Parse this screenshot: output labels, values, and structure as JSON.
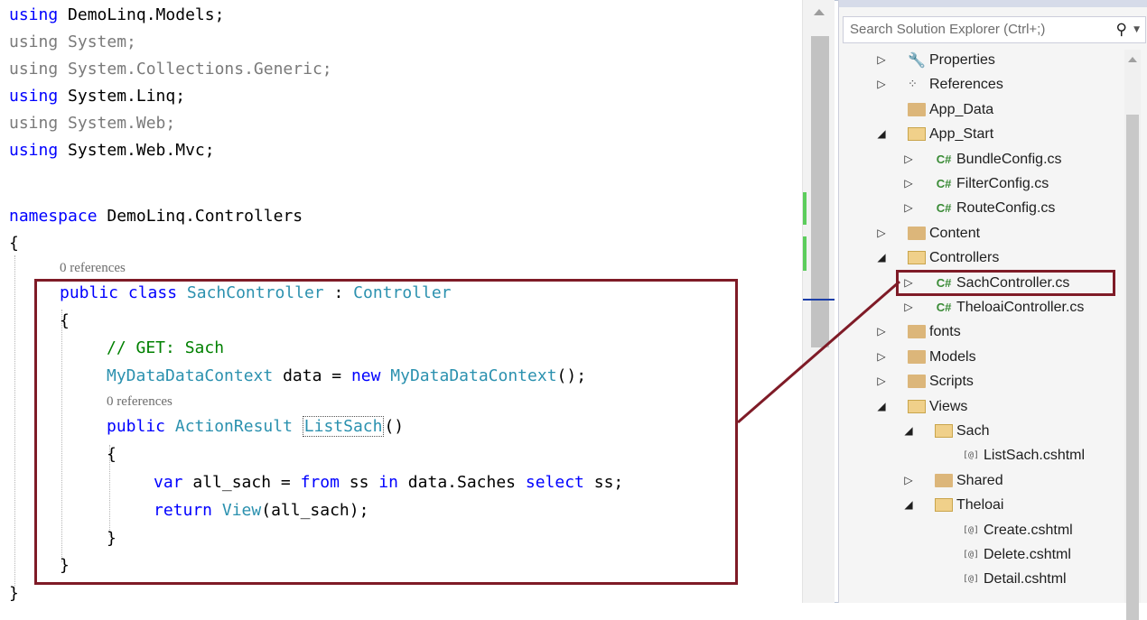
{
  "editor": {
    "lines": [
      {
        "kw": "using",
        "rest": " DemoLinq.Models;",
        "dim": false
      },
      {
        "kw": "using",
        "rest": " System;",
        "dim": true
      },
      {
        "kw": "using",
        "rest": " System.Collections.Generic;",
        "dim": true
      },
      {
        "kw": "using",
        "rest": " System.Linq;",
        "dim": false
      },
      {
        "kw": "using",
        "rest": " System.Web;",
        "dim": true
      },
      {
        "kw": "using",
        "rest": " System.Web.Mvc;",
        "dim": false
      }
    ],
    "namespace_kw": "namespace",
    "namespace_name": " DemoLinq.Controllers",
    "open_brace": "{",
    "codelens_class": "0 references",
    "class_public": "public",
    "class_kw": "class",
    "class_name": "SachController",
    "class_colon": " : ",
    "class_base": "Controller",
    "class_open": "{",
    "comment": "// GET: Sach",
    "field_type": "MyDataDataContext",
    "field_name": " data = ",
    "field_new": "new",
    "field_ctor": "MyDataDataContext",
    "field_end": "();",
    "codelens_method": "0 references",
    "method_public": "public",
    "method_type": "ActionResult",
    "method_name": "ListSach",
    "method_parens": "()",
    "method_open": "{",
    "stmt1_var": "var",
    "stmt1_a": " all_sach = ",
    "stmt1_from": "from",
    "stmt1_b": " ss ",
    "stmt1_in": "in",
    "stmt1_c": " data.Saches ",
    "stmt1_select": "select",
    "stmt1_d": " ss;",
    "stmt2_return": "return",
    "stmt2_view": "View",
    "stmt2_rest": "(all_sach);",
    "method_close": "}",
    "class_close": "}",
    "ns_close": "}"
  },
  "solution_explorer": {
    "search_placeholder": "Search Solution Explorer (Ctrl+;)",
    "search_icon": "search-icon",
    "items": [
      {
        "label": "Properties",
        "expander": "▷",
        "icon": "wrench-icon",
        "level": 0
      },
      {
        "label": "References",
        "expander": "▷",
        "icon": "references-icon",
        "level": 0
      },
      {
        "label": "App_Data",
        "expander": "",
        "icon": "folder-icon",
        "level": 0
      },
      {
        "label": "App_Start",
        "expander": "◢",
        "icon": "folder-open-icon",
        "level": 0
      },
      {
        "label": "BundleConfig.cs",
        "expander": "▷",
        "icon": "csharp-file-icon",
        "level": 1
      },
      {
        "label": "FilterConfig.cs",
        "expander": "▷",
        "icon": "csharp-file-icon",
        "level": 1
      },
      {
        "label": "RouteConfig.cs",
        "expander": "▷",
        "icon": "csharp-file-icon",
        "level": 1
      },
      {
        "label": "Content",
        "expander": "▷",
        "icon": "folder-icon",
        "level": 0
      },
      {
        "label": "Controllers",
        "expander": "◢",
        "icon": "folder-open-icon",
        "level": 0
      },
      {
        "label": "SachController.cs",
        "expander": "▷",
        "icon": "csharp-file-icon",
        "level": 1
      },
      {
        "label": "TheloaiController.cs",
        "expander": "▷",
        "icon": "csharp-file-icon",
        "level": 1
      },
      {
        "label": "fonts",
        "expander": "▷",
        "icon": "folder-icon",
        "level": 0
      },
      {
        "label": "Models",
        "expander": "▷",
        "icon": "folder-icon",
        "level": 0
      },
      {
        "label": "Scripts",
        "expander": "▷",
        "icon": "folder-icon",
        "level": 0
      },
      {
        "label": "Views",
        "expander": "◢",
        "icon": "folder-open-icon",
        "level": 0
      },
      {
        "label": "Sach",
        "expander": "◢",
        "icon": "folder-open-icon",
        "level": 1
      },
      {
        "label": "ListSach.cshtml",
        "expander": "",
        "icon": "razor-file-icon",
        "level": 2
      },
      {
        "label": "Shared",
        "expander": "▷",
        "icon": "folder-icon",
        "level": 1
      },
      {
        "label": "Theloai",
        "expander": "◢",
        "icon": "folder-open-icon",
        "level": 1
      },
      {
        "label": "Create.cshtml",
        "expander": "",
        "icon": "razor-file-icon",
        "level": 2
      },
      {
        "label": "Delete.cshtml",
        "expander": "",
        "icon": "razor-file-icon",
        "level": 2
      },
      {
        "label": "Detail.cshtml",
        "expander": "",
        "icon": "razor-file-icon",
        "level": 2
      }
    ],
    "cs_glyph": "C#",
    "razor_glyph": "[@]"
  },
  "colors": {
    "highlight_box": "#7f1b27",
    "keyword": "#0000ff",
    "type": "#2b91af",
    "comment": "#008000"
  }
}
